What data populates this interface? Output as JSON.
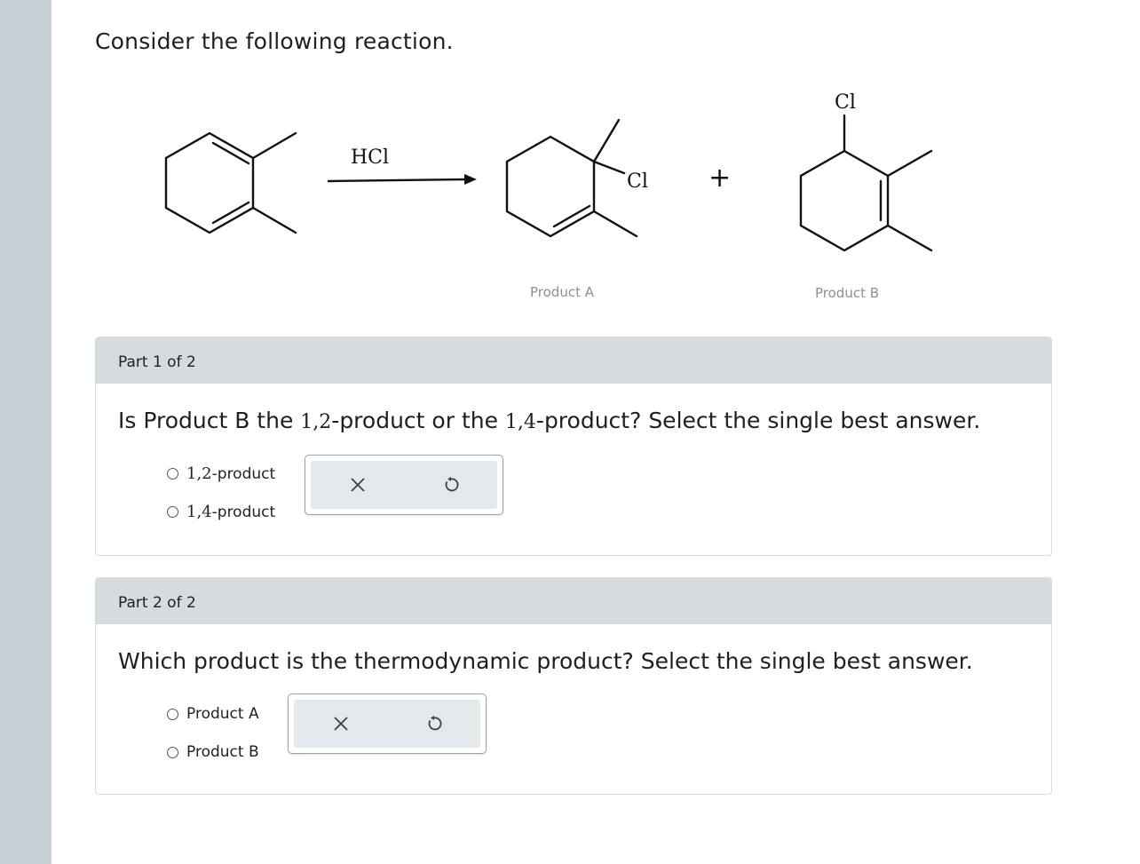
{
  "intro": "Consider the following reaction.",
  "reaction": {
    "reagent": "HCl",
    "product_a_cl": "Cl",
    "product_b_cl": "Cl",
    "plus": "+",
    "product_a_label": "Product A",
    "product_b_label": "Product B"
  },
  "part1": {
    "header": "Part 1 of 2",
    "question_pre": "Is Product B the ",
    "num1": "1,2",
    "question_mid": "-product or the ",
    "num2": "1,4",
    "question_post": "-product? Select the single best answer.",
    "options": [
      {
        "num": "1,2",
        "suffix": "-product"
      },
      {
        "num": "1,4",
        "suffix": "-product"
      }
    ]
  },
  "part2": {
    "header": "Part 2 of 2",
    "question": "Which product is the thermodynamic product? Select the single best answer.",
    "options": [
      "Product A",
      "Product B"
    ]
  },
  "tools": {
    "clear_icon": "close-icon",
    "reset_icon": "undo-icon"
  }
}
